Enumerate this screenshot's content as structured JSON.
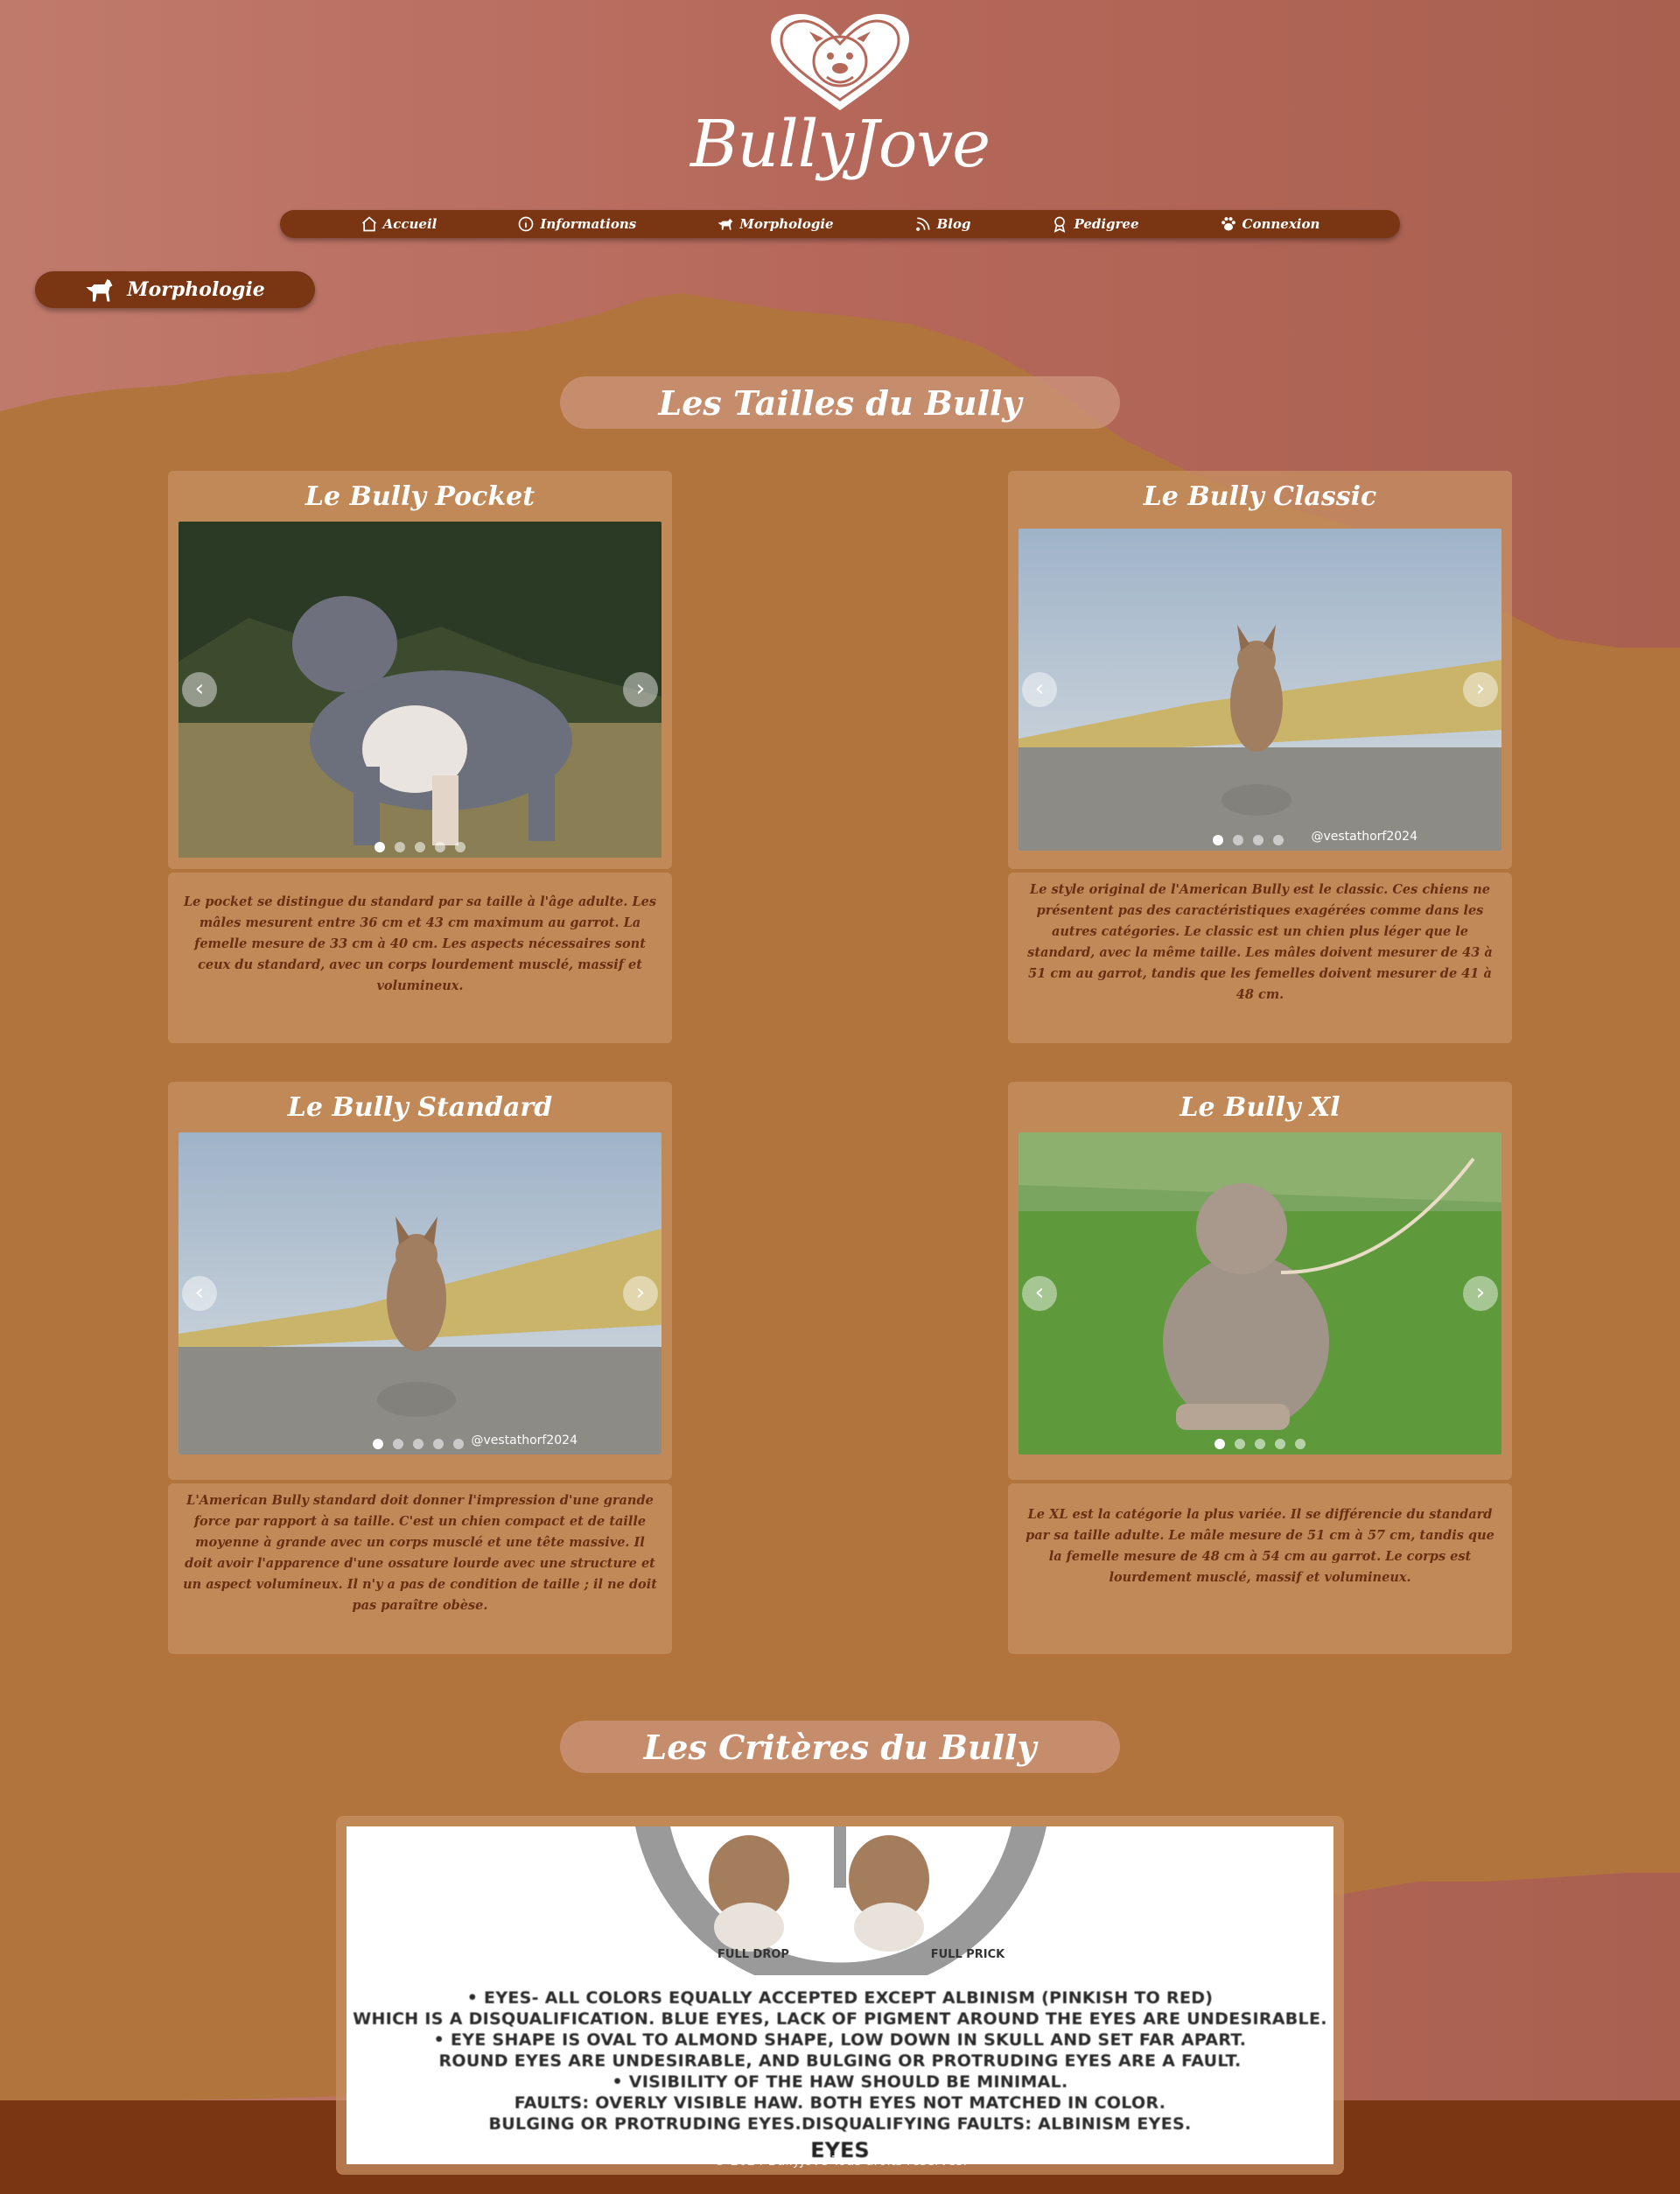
{
  "brand": {
    "name": "BullyJove",
    "logo": "bulldog-heart-logo"
  },
  "nav": {
    "items": [
      {
        "label": "Accueil",
        "icon": "home-icon"
      },
      {
        "label": "Informations",
        "icon": "info-icon"
      },
      {
        "label": "Morphologie",
        "icon": "dog-icon"
      },
      {
        "label": "Blog",
        "icon": "rss-icon"
      },
      {
        "label": "Pedigree",
        "icon": "badge-icon"
      },
      {
        "label": "Connexion",
        "icon": "paw-icon"
      }
    ]
  },
  "page": {
    "badge_label": "Morphologie",
    "badge_icon": "dog-icon"
  },
  "sections": {
    "sizes_title": "Les Tailles du Bully",
    "criteria_title": "Les Critères du Bully"
  },
  "cards": [
    {
      "title": "Le Bully Pocket",
      "text": "Le pocket se distingue du standard par sa taille à l'âge adulte. Les mâles mesurent entre 36 cm et 43 cm maximum au garrot. La femelle mesure de 33 cm à 40 cm. Les aspects nécessaires sont ceux du standard, avec un corps lourdement musclé, massif et volumineux.",
      "slides": 5,
      "active_slide": 1,
      "watermark": ""
    },
    {
      "title": "Le Bully Classic",
      "text": "Le style original de l'American Bully est le classic. Ces chiens ne présentent pas des caractéristiques exagérées comme dans les autres catégories. Le classic est un chien plus léger que le standard, avec la même taille. Les mâles doivent mesurer de 43 à 51 cm au garrot, tandis que les femelles doivent mesurer de 41 à 48 cm.",
      "slides": 4,
      "active_slide": 1,
      "watermark": "@vestathorf2024"
    },
    {
      "title": "Le Bully Standard",
      "text": "L'American Bully standard doit donner l'impression d'une grande force par rapport à sa taille. C'est un chien compact et de taille moyenne à grande avec un corps musclé et une tête massive. Il doit avoir l'apparence d'une ossature lourde avec une structure et un aspect volumineux. Il n'y a pas de condition de taille ; il ne doit pas paraître obèse.",
      "slides": 5,
      "active_slide": 1,
      "watermark": "@vestathorf2024"
    },
    {
      "title": "Le Bully Xl",
      "text": "Le XL est la catégorie la plus variée. Il se différencie du standard par sa taille adulte. Le mâle mesure de 51 cm à 57 cm, tandis que la femelle mesure de 48 cm à 54 cm au garrot. Le corps est lourdement musclé, massif et volumineux.",
      "slides": 5,
      "active_slide": 1,
      "watermark": ""
    }
  ],
  "criteria_image": {
    "labels": [
      "FULL DROP",
      "FULL PRICK"
    ],
    "lines": [
      "• EYES- ALL COLORS EQUALLY ACCEPTED EXCEPT ALBINISM (PINKISH TO RED)",
      "WHICH IS A DISQUALIFICATION. BLUE EYES, LACK OF PIGMENT AROUND THE EYES ARE UNDESIRABLE.",
      "• EYE SHAPE IS OVAL TO ALMOND SHAPE, LOW DOWN IN SKULL AND SET FAR APART.",
      "ROUND EYES ARE UNDESIRABLE, AND BULGING OR PROTRUDING EYES ARE A FAULT.",
      "• VISIBILITY OF THE HAW SHOULD BE MINIMAL.",
      "FAULTS: OVERLY VISIBLE HAW. BOTH EYES NOT MATCHED IN COLOR.",
      "BULGING OR PROTRUDING EYES.DISQUALIFYING FAULTS: ALBINISM EYES."
    ],
    "heading": "EYES"
  },
  "footer": {
    "text": "© 2024 BullyJove Tous droits réservés."
  },
  "colors": {
    "brown_dark": "#7a3512",
    "terrain": "#b0743c",
    "rose": "#b5685a"
  }
}
